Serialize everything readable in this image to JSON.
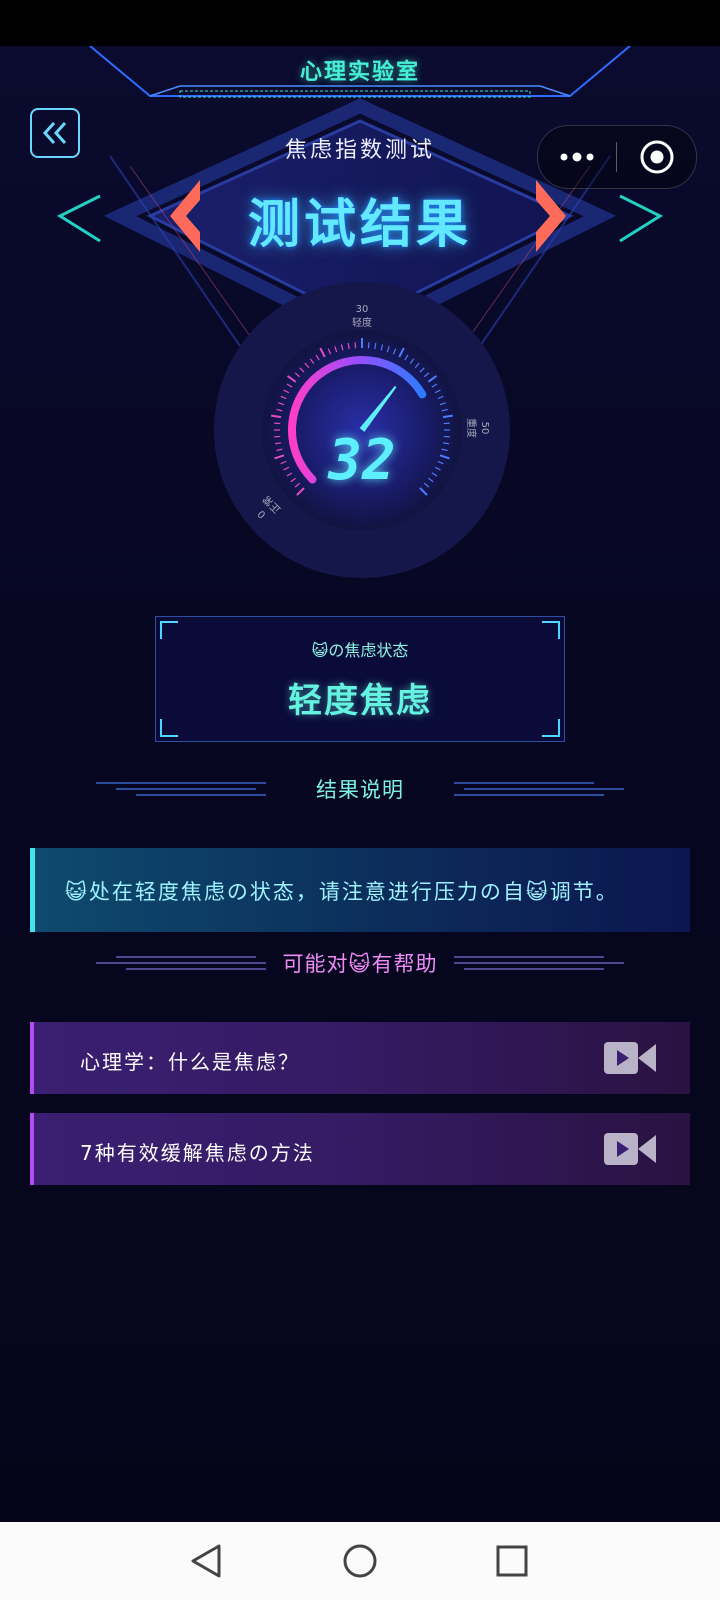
{
  "app": {
    "title": "心理实验室"
  },
  "capsule": {
    "more_icon": "more-dots-icon",
    "close_icon": "target-circle-icon"
  },
  "header": {
    "subtitle": "焦虑指数测试",
    "title": "测试结果"
  },
  "gauge": {
    "score": "32",
    "value": 32,
    "max": 50,
    "ticks": [
      {
        "value": "0",
        "label": "正常"
      },
      {
        "value": "30",
        "label": "轻度"
      },
      {
        "value": "50",
        "label": "重度"
      }
    ]
  },
  "state": {
    "label": "😺の焦虑状态",
    "value": "轻度焦虑"
  },
  "result_section": {
    "title": "结果说明",
    "text": "😺处在轻度焦虑の状态，请注意进行压力の自😺调节。"
  },
  "help_section": {
    "title": "可能对😺有帮助",
    "items": [
      {
        "label": "心理学：什么是焦虑？",
        "icon": "video-icon"
      },
      {
        "label": "7种有效缓解焦虑の方法",
        "icon": "video-icon"
      }
    ]
  },
  "colors": {
    "cyan": "#46f0d6",
    "headline": "#62e9ff",
    "purple": "#b44cf2",
    "arrow": "#ff6a5a"
  },
  "navbar": {
    "back_icon": "triangle-back-icon",
    "home_icon": "circle-home-icon",
    "recents_icon": "square-recents-icon"
  }
}
